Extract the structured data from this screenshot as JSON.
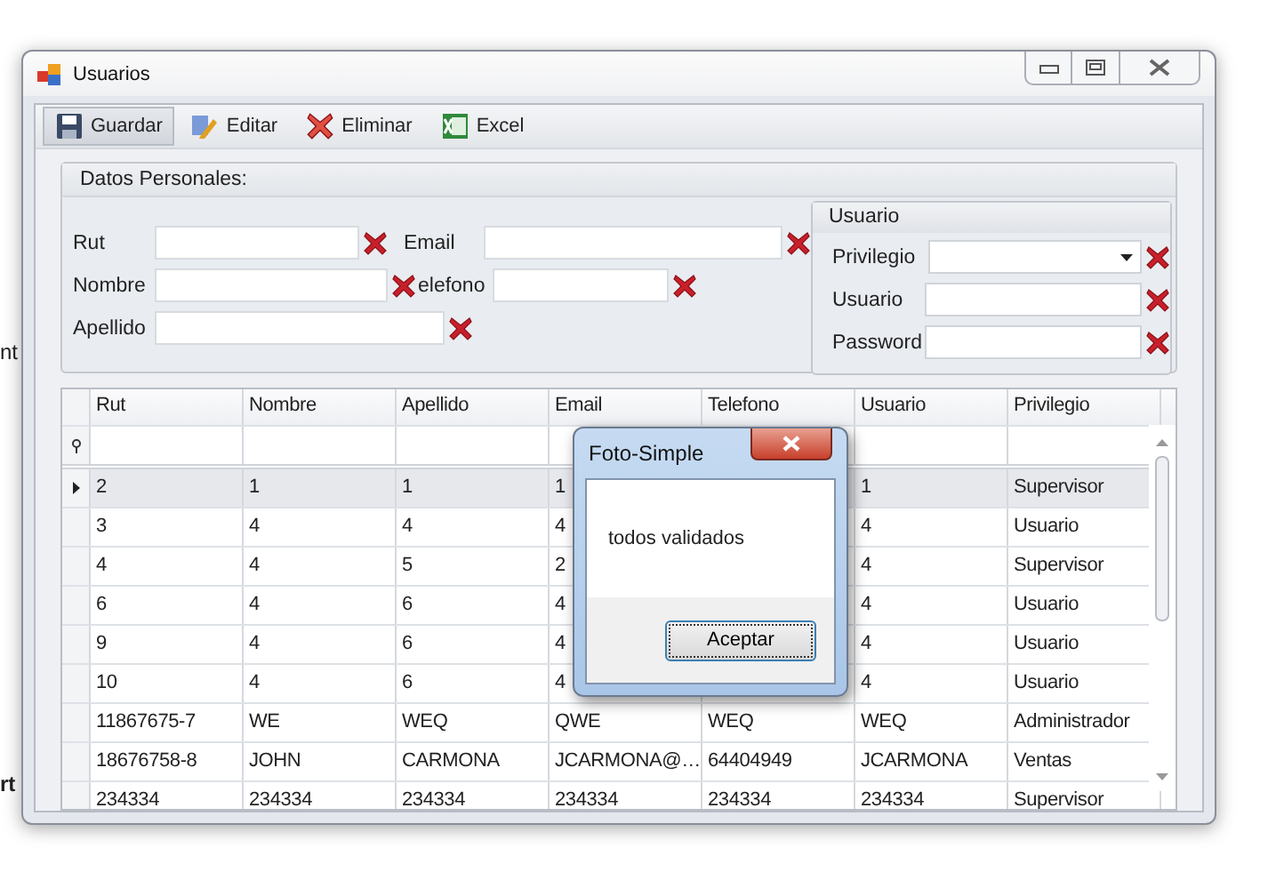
{
  "background_texts": [
    "nt",
    "rt"
  ],
  "window": {
    "title": "Usuarios"
  },
  "toolbar": [
    {
      "label": "Guardar",
      "kind": "save",
      "selected": true
    },
    {
      "label": "Editar",
      "kind": "edit",
      "selected": false
    },
    {
      "label": "Eliminar",
      "kind": "delete",
      "selected": false
    },
    {
      "label": "Excel",
      "kind": "excel",
      "selected": false
    }
  ],
  "personal_group": {
    "title": "Datos Personales:",
    "rows": [
      [
        {
          "label": "Rut"
        },
        {
          "label": "Email"
        }
      ],
      [
        {
          "label": "Nombre"
        },
        {
          "label": "elefono"
        }
      ],
      [
        {
          "label": "Apellido"
        }
      ]
    ]
  },
  "user_group": {
    "title": "Usuario",
    "fields": [
      {
        "label": "Privilegio",
        "kind": "dropdown"
      },
      {
        "label": "Usuario",
        "kind": "text"
      },
      {
        "label": "Password",
        "kind": "text"
      }
    ]
  },
  "table": {
    "columns": [
      "Rut",
      "Nombre",
      "Apellido",
      "Email",
      "Telefono",
      "Usuario",
      "Privilegio"
    ],
    "rows": [
      {
        "selected": true,
        "cells": [
          "2",
          "1",
          "1",
          "1",
          null,
          "1",
          "Supervisor"
        ]
      },
      {
        "selected": false,
        "cells": [
          "3",
          "4",
          "4",
          "4",
          null,
          "4",
          "Usuario"
        ]
      },
      {
        "selected": false,
        "cells": [
          "4",
          "4",
          "5",
          "2",
          null,
          "4",
          "Supervisor"
        ]
      },
      {
        "selected": false,
        "cells": [
          "6",
          "4",
          "6",
          "4",
          null,
          "4",
          "Usuario"
        ]
      },
      {
        "selected": false,
        "cells": [
          "9",
          "4",
          "6",
          "4",
          null,
          "4",
          "Usuario"
        ]
      },
      {
        "selected": false,
        "cells": [
          "10",
          "4",
          "6",
          "4",
          null,
          "4",
          "Usuario"
        ]
      },
      {
        "selected": false,
        "cells": [
          "11867675-7",
          "WE",
          "WEQ",
          "QWE",
          "WEQ",
          "WEQ",
          "Administrador"
        ]
      },
      {
        "selected": false,
        "cells": [
          "18676758-8",
          "JOHN",
          "CARMONA",
          "JCARMONA@…",
          "64404949",
          "JCARMONA",
          "Ventas"
        ]
      },
      {
        "selected": false,
        "cells": [
          "234334",
          "234334",
          "234334",
          "234334",
          "234334",
          "234334",
          "Supervisor"
        ]
      }
    ]
  },
  "dialog": {
    "title": "Foto-Simple",
    "message": "todos validados",
    "button": "Aceptar"
  }
}
